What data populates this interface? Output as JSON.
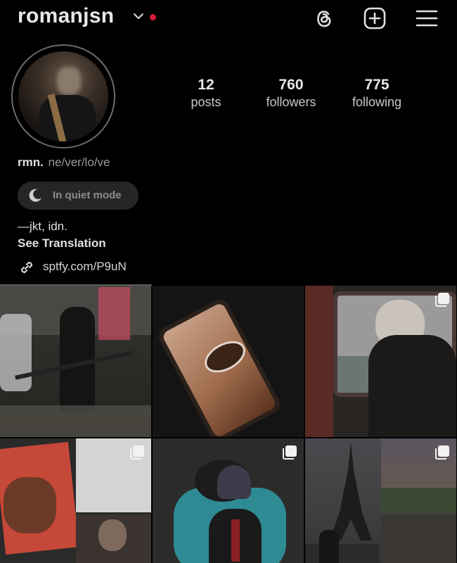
{
  "header": {
    "username": "romanjsn",
    "icons": [
      "chevron-down-icon",
      "notification-dot",
      "threads-icon",
      "create-post-icon",
      "menu-icon"
    ],
    "accent_dot_color": "#d61c39"
  },
  "stats": {
    "posts": {
      "value": "12",
      "label": "posts"
    },
    "followers": {
      "value": "760",
      "label": "followers"
    },
    "following": {
      "value": "775",
      "label": "following"
    }
  },
  "bio": {
    "name": "rmn.",
    "pronouns": "ne/ver/lo/ve",
    "quiet_mode": "In quiet mode",
    "line": "—jkt, idn.",
    "see_translation": "See Translation",
    "link": "sptfy.com/P9uN"
  },
  "grid": {
    "posts": [
      {
        "name": "post-street-photo",
        "multi": false
      },
      {
        "name": "post-phone-eye",
        "multi": false
      },
      {
        "name": "post-train-window",
        "multi": true
      },
      {
        "name": "post-magazine-collage",
        "multi": true
      },
      {
        "name": "post-bumper-car",
        "multi": true
      },
      {
        "name": "post-eiffel-collage",
        "multi": true
      }
    ]
  }
}
